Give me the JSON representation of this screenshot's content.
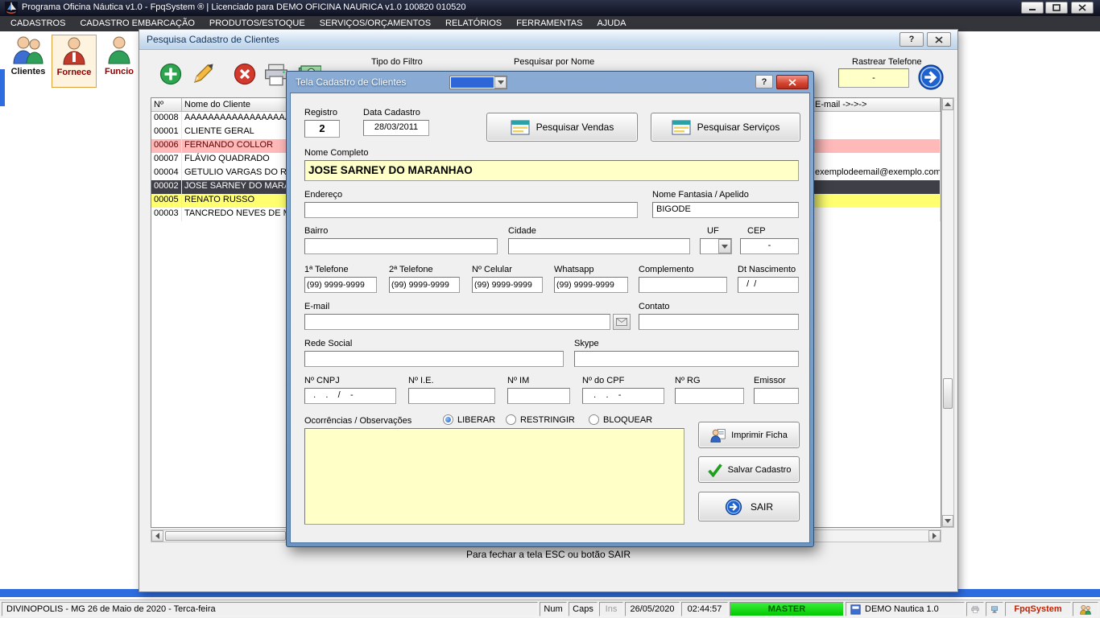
{
  "colors": {
    "accent_blue": "#2e6de0",
    "field_yellow": "#ffffc8",
    "selected_row_bg": "#3f3f48",
    "blocked_row_bg": "#ffb9b9",
    "restricted_row_bg": "#ffff70",
    "master_green": "#00dc00",
    "brand_red": "#c22000"
  },
  "icons": {
    "help": "?"
  },
  "titlebar": {
    "title": "Programa Oficina Náutica v1.0 - FpqSystem ® | Licenciado para  DEMO OFICINA NAURICA v1.0 100820 010520"
  },
  "menubar": {
    "items": [
      "CADASTROS",
      "CADASTRO EMBARCAÇÃO",
      "PRODUTOS/ESTOQUE",
      "SERVIÇOS/ORÇAMENTOS",
      "RELATÓRIOS",
      "FERRAMENTAS",
      "AJUDA"
    ]
  },
  "main_toolbar": {
    "buttons": [
      {
        "label": "Clientes"
      },
      {
        "label": "Fornece"
      },
      {
        "label": "Funcio"
      }
    ]
  },
  "search_window": {
    "title": "Pesquisa Cadastro de Clientes",
    "filter_type_label": "Tipo do Filtro",
    "search_by_name_label": "Pesquisar por Nome",
    "trace_phone_label": "Rastrear Telefone",
    "trace_phone_value": "-",
    "grid": {
      "col_num": "Nº",
      "col_name": "Nome do Cliente",
      "col_email": "E-mail ->->->",
      "rows": [
        {
          "num": "00008",
          "name": "AAAAAAAAAAAAAAAAAAAAAAAAA",
          "email": "",
          "style": "normal"
        },
        {
          "num": "00001",
          "name": "CLIENTE GERAL",
          "email": "",
          "style": "normal"
        },
        {
          "num": "00006",
          "name": "FERNANDO COLLOR",
          "email": "",
          "style": "blocked"
        },
        {
          "num": "00007",
          "name": "FLÁVIO QUADRADO",
          "email": "",
          "style": "normal"
        },
        {
          "num": "00004",
          "name": "GETULIO VARGAS DO RS",
          "email": "exemplodeemail@exemplo.com.br",
          "style": "normal"
        },
        {
          "num": "00002",
          "name": "JOSE SARNEY DO MARA",
          "email": "",
          "style": "selected"
        },
        {
          "num": "00005",
          "name": "RENATO RUSSO",
          "email": "",
          "style": "restricted"
        },
        {
          "num": "00003",
          "name": "TANCREDO NEVES DE M",
          "email": "",
          "style": "normal"
        }
      ]
    },
    "footer_hint": "Para fechar a tela ESC ou botão SAIR"
  },
  "dialog": {
    "title": "Tela Cadastro de Clientes",
    "registro": {
      "label": "Registro",
      "value": "2"
    },
    "data_cadastro": {
      "label": "Data Cadastro",
      "value": "28/03/2011"
    },
    "nome_completo": {
      "label": "Nome Completo",
      "value": "JOSE SARNEY DO MARANHAO"
    },
    "endereco": {
      "label": "Endereço",
      "value": ""
    },
    "nome_fantasia": {
      "label": "Nome Fantasia / Apelido",
      "value": "BIGODE"
    },
    "bairro": {
      "label": "Bairro",
      "value": ""
    },
    "cidade": {
      "label": "Cidade",
      "value": ""
    },
    "uf": {
      "label": "UF",
      "value": ""
    },
    "cep": {
      "label": "CEP",
      "value": "-"
    },
    "tel1": {
      "label": "1ª Telefone",
      "value": "(99) 9999-9999"
    },
    "tel2": {
      "label": "2ª Telefone",
      "value": "(99) 9999-9999"
    },
    "celular": {
      "label": "Nº Celular",
      "value": "(99) 9999-9999"
    },
    "whatsapp": {
      "label": "Whatsapp",
      "value": "(99) 9999-9999"
    },
    "complemento": {
      "label": "Complemento",
      "value": ""
    },
    "dt_nascimento": {
      "label": "Dt Nascimento",
      "value": "  /  /"
    },
    "email": {
      "label": "E-mail",
      "value": ""
    },
    "contato": {
      "label": "Contato",
      "value": ""
    },
    "rede_social": {
      "label": "Rede Social",
      "value": ""
    },
    "skype": {
      "label": "Skype",
      "value": ""
    },
    "cnpj": {
      "label": "Nº CNPJ",
      "value": "  .    .    /    -"
    },
    "ie": {
      "label": "Nº I.E.",
      "value": ""
    },
    "im": {
      "label": "Nº IM",
      "value": ""
    },
    "cpf": {
      "label": "Nº do CPF",
      "value": "   .    .    -"
    },
    "rg": {
      "label": "Nº RG",
      "value": ""
    },
    "emissor": {
      "label": "Emissor",
      "value": ""
    },
    "ocorrencias_label": "Ocorrências / Observações",
    "radios": {
      "liberar": "LIBERAR",
      "restringir": "RESTRINGIR",
      "bloquear": "BLOQUEAR"
    },
    "observacoes": "",
    "buttons": {
      "pesquisar_vendas": "Pesquisar Vendas",
      "pesquisar_servicos": "Pesquisar Serviços",
      "imprimir": "Imprimir Ficha",
      "salvar": "Salvar Cadastro",
      "sair": "SAIR"
    }
  },
  "statusbar": {
    "location": "DIVINOPOLIS - MG 26 de Maio de 2020 - Terca-feira",
    "num": "Num",
    "caps": "Caps",
    "ins": "Ins",
    "date": "26/05/2020",
    "time": "02:44:57",
    "master": "MASTER",
    "demo": "DEMO Nautica 1.0",
    "brand": "FpqSystem"
  }
}
